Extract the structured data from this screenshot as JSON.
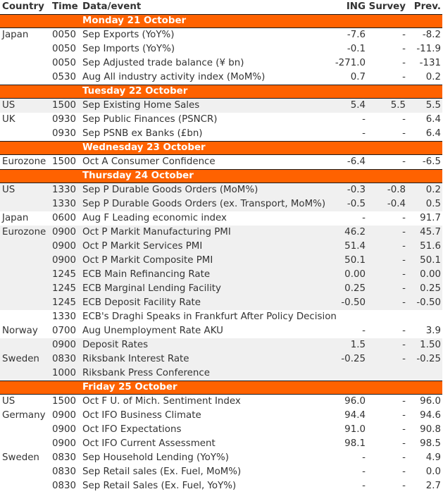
{
  "colors": {
    "accent": "#ff6200",
    "shade": "#f0f0f0",
    "text": "#333333"
  },
  "header": {
    "country": "Country",
    "time": "Time",
    "event": "Data/event",
    "ing": "ING",
    "survey": "Survey",
    "prev": "Prev."
  },
  "days": [
    {
      "label": "Monday 21 October",
      "rows": [
        {
          "country": "Japan",
          "time": "0050",
          "event": "Sep Exports (YoY%)",
          "ing": "-7.6",
          "survey": "-",
          "prev": "-8.2",
          "shaded": false
        },
        {
          "country": "",
          "time": "0050",
          "event": "Sep Imports (YoY%)",
          "ing": "-0.1",
          "survey": "-",
          "prev": "-11.9",
          "shaded": false
        },
        {
          "country": "",
          "time": "0050",
          "event": "Sep Adjusted trade balance (¥ bn)",
          "ing": "-271.0",
          "survey": "-",
          "prev": "-131",
          "shaded": false
        },
        {
          "country": "",
          "time": "0530",
          "event": "Aug All industry activity index (MoM%)",
          "ing": "0.7",
          "survey": "-",
          "prev": "0.2",
          "shaded": false
        }
      ]
    },
    {
      "label": "Tuesday 22 October",
      "rows": [
        {
          "country": "US",
          "time": "1500",
          "event": "Sep Existing Home Sales",
          "ing": "5.4",
          "survey": "5.5",
          "prev": "5.5",
          "shaded": true
        },
        {
          "country": "UK",
          "time": "0930",
          "event": "Sep Public Finances (PSNCR)",
          "ing": "-",
          "survey": "-",
          "prev": "6.4",
          "shaded": false
        },
        {
          "country": "",
          "time": "0930",
          "event": "Sep PSNB ex Banks (£bn)",
          "ing": "-",
          "survey": "-",
          "prev": "6.4",
          "shaded": false
        }
      ]
    },
    {
      "label": "Wednesday 23 October",
      "rows": [
        {
          "country": "Eurozone",
          "time": "1500",
          "event": "Oct A Consumer Confidence",
          "ing": "-6.4",
          "survey": "-",
          "prev": "-6.5",
          "shaded": false
        }
      ]
    },
    {
      "label": "Thursday 24 October",
      "rows": [
        {
          "country": "US",
          "time": "1330",
          "event": "Sep P Durable Goods Orders (MoM%)",
          "ing": "-0.3",
          "survey": "-0.8",
          "prev": "0.2",
          "shaded": true
        },
        {
          "country": "",
          "time": "1330",
          "event": "Sep P Durable Goods Orders (ex. Transport, MoM%)",
          "ing": "-0.5",
          "survey": "-0.4",
          "prev": "0.5",
          "shaded": true
        },
        {
          "country": "Japan",
          "time": "0600",
          "event": "Aug F Leading economic index",
          "ing": "-",
          "survey": "-",
          "prev": "91.7",
          "shaded": false
        },
        {
          "country": "Eurozone",
          "time": "0900",
          "event": "Oct P Markit Manufacturing PMI",
          "ing": "46.2",
          "survey": "-",
          "prev": "45.7",
          "shaded": true
        },
        {
          "country": "",
          "time": "0900",
          "event": "Oct P Markit Services PMI",
          "ing": "51.4",
          "survey": "-",
          "prev": "51.6",
          "shaded": true
        },
        {
          "country": "",
          "time": "0900",
          "event": "Oct P Markit Composite PMI",
          "ing": "50.1",
          "survey": "-",
          "prev": "50.1",
          "shaded": true
        },
        {
          "country": "",
          "time": "1245",
          "event": "ECB Main Refinancing Rate",
          "ing": "0.00",
          "survey": "-",
          "prev": "0.00",
          "shaded": true
        },
        {
          "country": "",
          "time": "1245",
          "event": "ECB Marginal Lending Facility",
          "ing": "0.25",
          "survey": "-",
          "prev": "0.25",
          "shaded": true
        },
        {
          "country": "",
          "time": "1245",
          "event": "ECB Deposit Facility Rate",
          "ing": "-0.50",
          "survey": "-",
          "prev": "-0.50",
          "shaded": true
        },
        {
          "country": "",
          "time": "1330",
          "event": "ECB's Draghi Speaks in Frankfurt After Policy Decision",
          "ing": "",
          "survey": "",
          "prev": "",
          "shaded": false
        },
        {
          "country": "Norway",
          "time": "0700",
          "event": "Aug Unemployment Rate AKU",
          "ing": "-",
          "survey": "-",
          "prev": "3.9",
          "shaded": false
        },
        {
          "country": "",
          "time": "0900",
          "event": "Deposit Rates",
          "ing": "1.5",
          "survey": "-",
          "prev": "1.50",
          "shaded": true
        },
        {
          "country": "Sweden",
          "time": "0830",
          "event": "Riksbank Interest Rate",
          "ing": "-0.25",
          "survey": "-",
          "prev": "-0.25",
          "shaded": true
        },
        {
          "country": "",
          "time": "1000",
          "event": "Riksbank Press Conference",
          "ing": "",
          "survey": "",
          "prev": "",
          "shaded": true
        }
      ]
    },
    {
      "label": "Friday 25 October",
      "rows": [
        {
          "country": "US",
          "time": "1500",
          "event": "Oct F U. of Mich. Sentiment Index",
          "ing": "96.0",
          "survey": "-",
          "prev": "96.0",
          "shaded": false
        },
        {
          "country": "Germany",
          "time": "0900",
          "event": "Oct IFO Business Climate",
          "ing": "94.4",
          "survey": "-",
          "prev": "94.6",
          "shaded": false
        },
        {
          "country": "",
          "time": "0900",
          "event": "Oct IFO Expectations",
          "ing": "91.0",
          "survey": "-",
          "prev": "90.8",
          "shaded": false
        },
        {
          "country": "",
          "time": "0900",
          "event": "Oct IFO Current Assessment",
          "ing": "98.1",
          "survey": "-",
          "prev": "98.5",
          "shaded": false
        },
        {
          "country": "Sweden",
          "time": "0830",
          "event": "Sep Household Lending (YoY%)",
          "ing": "-",
          "survey": "-",
          "prev": "4.9",
          "shaded": false
        },
        {
          "country": "",
          "time": "0830",
          "event": "Sep Retail sales (Ex. Fuel, MoM%)",
          "ing": "-",
          "survey": "-",
          "prev": "0.0",
          "shaded": false
        },
        {
          "country": "",
          "time": "0830",
          "event": "Sep Retail Sales (Ex. Fuel, YoY%)",
          "ing": "-",
          "survey": "-",
          "prev": "2.7",
          "shaded": false
        }
      ]
    }
  ]
}
